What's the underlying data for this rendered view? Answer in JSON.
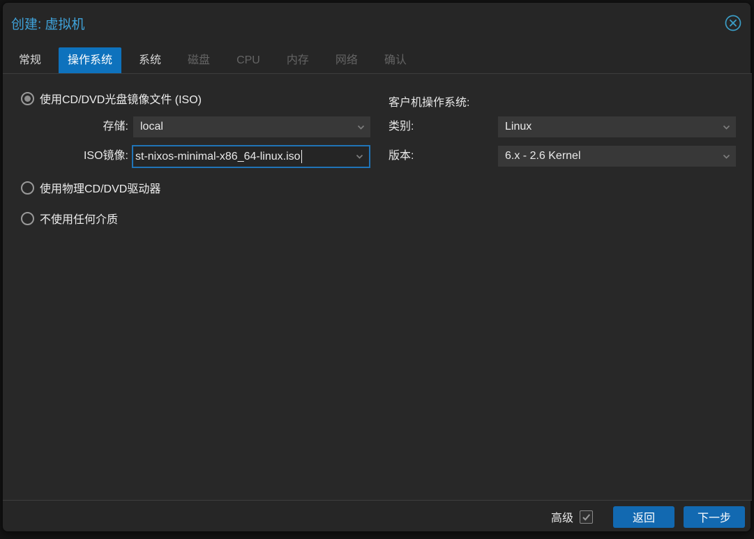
{
  "window": {
    "title": "创建: 虚拟机"
  },
  "tabs": [
    {
      "label": "常规",
      "state": "normal"
    },
    {
      "label": "操作系统",
      "state": "active"
    },
    {
      "label": "系统",
      "state": "normal"
    },
    {
      "label": "磁盘",
      "state": "disabled"
    },
    {
      "label": "CPU",
      "state": "disabled"
    },
    {
      "label": "内存",
      "state": "disabled"
    },
    {
      "label": "网络",
      "state": "disabled"
    },
    {
      "label": "确认",
      "state": "disabled"
    }
  ],
  "form": {
    "left": {
      "radio_iso": {
        "label": "使用CD/DVD光盘镜像文件 (ISO)",
        "selected": true
      },
      "storage": {
        "label": "存储:",
        "value": "local"
      },
      "iso_image": {
        "label": "ISO镜像:",
        "value": "st-nixos-minimal-x86_64-linux.iso"
      },
      "radio_physical": {
        "label": "使用物理CD/DVD驱动器",
        "selected": false
      },
      "radio_none": {
        "label": "不使用任何介质",
        "selected": false
      }
    },
    "right": {
      "heading": "客户机操作系统:",
      "type": {
        "label": "类别:",
        "value": "Linux"
      },
      "version": {
        "label": "版本:",
        "value": "6.x - 2.6 Kernel"
      }
    }
  },
  "footer": {
    "advanced_label": "高级",
    "advanced_checked": true,
    "back_label": "返回",
    "next_label": "下一步"
  },
  "colors": {
    "accent_tab": "#0e72bd",
    "button_blue": "#1269b1",
    "title_blue": "#3fa2d9",
    "close_icon_blue": "#3b9ec7",
    "focus_border": "#2074b7",
    "dialog_bg": "#262626",
    "panel_bg": "#282828",
    "field_bg": "#383838"
  }
}
